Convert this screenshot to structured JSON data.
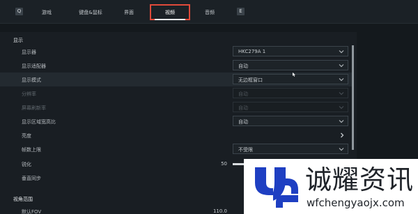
{
  "tabs": {
    "left_key": "Q",
    "right_key": "E",
    "items": [
      {
        "label": "游戏"
      },
      {
        "label": "键盘&鼠标"
      },
      {
        "label": "界面"
      },
      {
        "label": "视频"
      },
      {
        "label": "音频"
      }
    ],
    "active": "视频"
  },
  "display_section": {
    "title": "显示",
    "rows": [
      {
        "label": "显示器",
        "value": "HKC279A 1",
        "control": "dropdown"
      },
      {
        "label": "显示适配器",
        "value": "自动",
        "control": "dropdown"
      },
      {
        "label": "显示模式",
        "value": "无边框窗口",
        "control": "dropdown",
        "highlighted": true
      },
      {
        "label": "分辨率",
        "value": "自动",
        "control": "dropdown",
        "disabled": true
      },
      {
        "label": "屏幕刷新率",
        "value": "自动",
        "control": "dropdown",
        "disabled": true
      },
      {
        "label": "显示区域宽高比",
        "value": "自动",
        "control": "dropdown"
      },
      {
        "label": "亮度",
        "control": "arrow"
      },
      {
        "label": "帧数上限",
        "value": "不受限",
        "control": "dropdown"
      },
      {
        "label": "锐化",
        "value": "50",
        "control": "slider",
        "fraction": 0.5
      },
      {
        "label": "垂直同步",
        "control": "none"
      }
    ]
  },
  "fov_section": {
    "title": "视角范围",
    "rows": [
      {
        "label": "默认FOV",
        "value": "110.0",
        "control": "slider"
      }
    ]
  },
  "watermark": {
    "name": "诚耀资讯",
    "url": "wfchengyaojx.com"
  },
  "colors": {
    "tab_highlight": "#e04a3a",
    "background": "#14191d",
    "panel": "#1a1f24",
    "watermark_blue": "#1e3fc2"
  }
}
